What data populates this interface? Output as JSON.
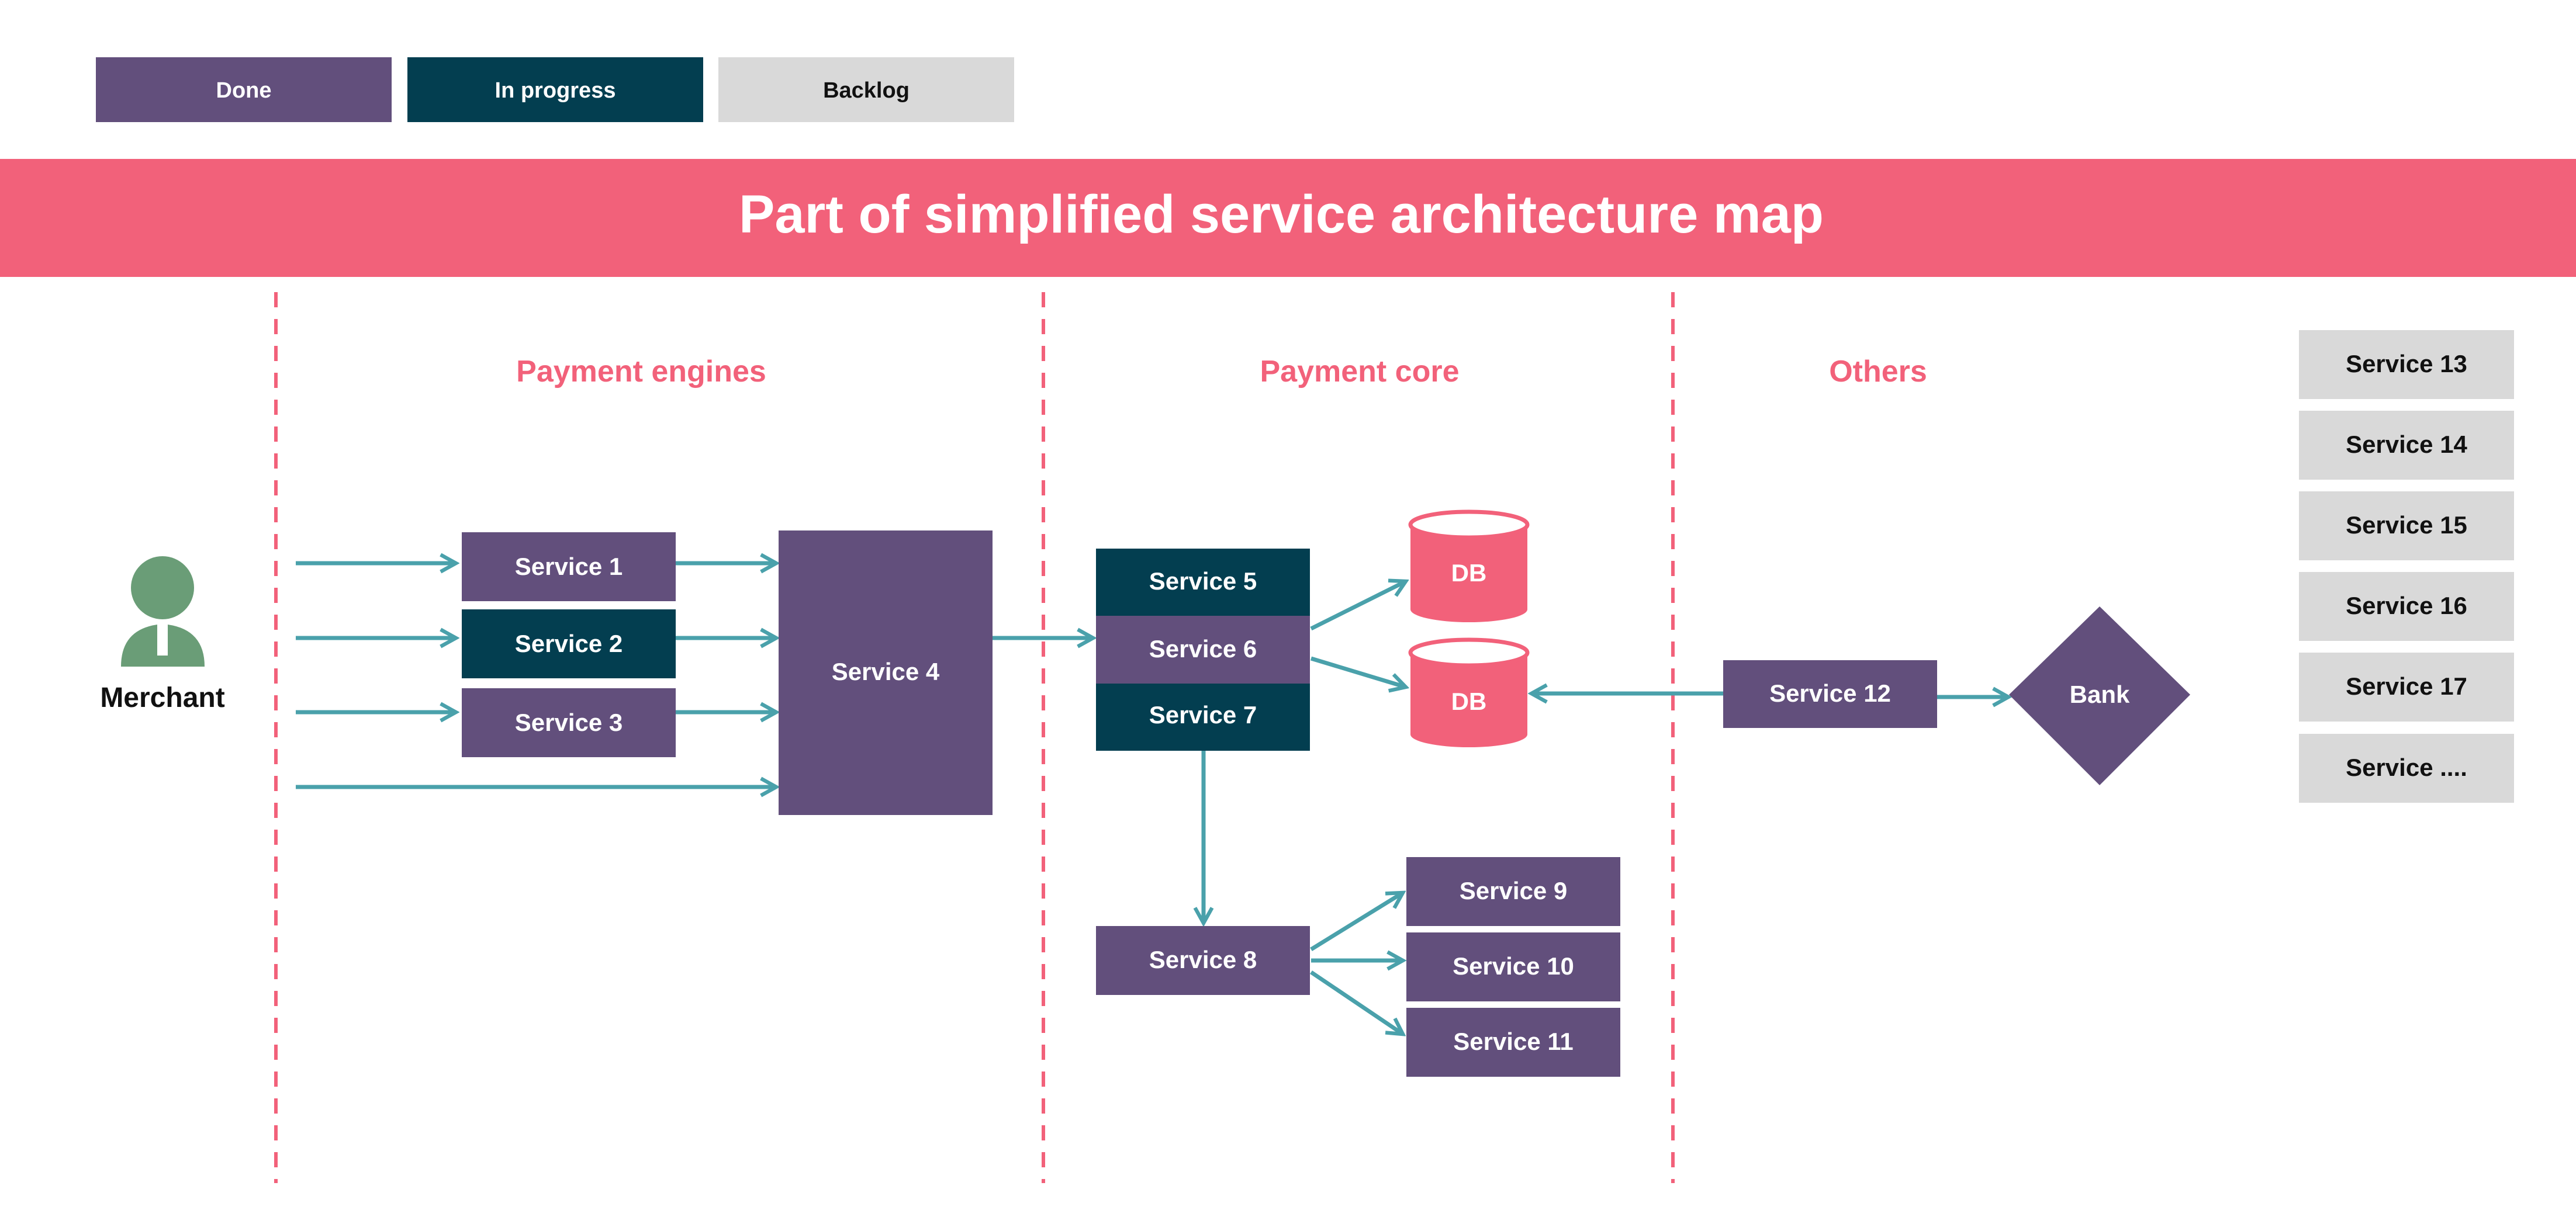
{
  "colors": {
    "done": "#624f7c",
    "in_progress": "#033e50",
    "backlog": "#d9d9d9",
    "accent": "#f2617a",
    "arrow": "#4aa1ab",
    "actor": "#6a9d77",
    "db": "#f2617a"
  },
  "legend": [
    {
      "label": "Done",
      "status": "done"
    },
    {
      "label": "In progress",
      "status": "in_progress"
    },
    {
      "label": "Backlog",
      "status": "backlog"
    }
  ],
  "banner": {
    "title": "Part of simplified service architecture map"
  },
  "sections": [
    {
      "id": "payment-engines",
      "label": "Payment engines"
    },
    {
      "id": "payment-core",
      "label": "Payment core"
    },
    {
      "id": "others",
      "label": "Others"
    }
  ],
  "actor": {
    "label": "Merchant",
    "icon": "person-icon"
  },
  "nodes": [
    {
      "id": "s1",
      "label": "Service 1",
      "status": "done"
    },
    {
      "id": "s2",
      "label": "Service 2",
      "status": "in_progress"
    },
    {
      "id": "s3",
      "label": "Service 3",
      "status": "done"
    },
    {
      "id": "s4",
      "label": "Service 4",
      "status": "done"
    },
    {
      "id": "s5",
      "label": "Service 5",
      "status": "in_progress"
    },
    {
      "id": "s6",
      "label": "Service 6",
      "status": "done"
    },
    {
      "id": "s7",
      "label": "Service 7",
      "status": "in_progress"
    },
    {
      "id": "s8",
      "label": "Service 8",
      "status": "done"
    },
    {
      "id": "s9",
      "label": "Service 9",
      "status": "done"
    },
    {
      "id": "s10",
      "label": "Service 10",
      "status": "done"
    },
    {
      "id": "s11",
      "label": "Service 11",
      "status": "done"
    },
    {
      "id": "s12",
      "label": "Service 12",
      "status": "done"
    },
    {
      "id": "db1",
      "label": "DB",
      "type": "database"
    },
    {
      "id": "db2",
      "label": "DB",
      "type": "database"
    },
    {
      "id": "bank",
      "label": "Bank",
      "type": "external",
      "status": "done"
    }
  ],
  "backlog_list": [
    {
      "label": "Service 13"
    },
    {
      "label": "Service 14"
    },
    {
      "label": "Service 15"
    },
    {
      "label": "Service 16"
    },
    {
      "label": "Service 17"
    },
    {
      "label": "Service ...."
    }
  ],
  "edges": [
    {
      "from": "merchant",
      "to": "s1"
    },
    {
      "from": "merchant",
      "to": "s2"
    },
    {
      "from": "merchant",
      "to": "s3"
    },
    {
      "from": "merchant",
      "to": "s4"
    },
    {
      "from": "s1",
      "to": "s4"
    },
    {
      "from": "s2",
      "to": "s4"
    },
    {
      "from": "s3",
      "to": "s4"
    },
    {
      "from": "s4",
      "to": "s6"
    },
    {
      "from": "s6",
      "to": "db1"
    },
    {
      "from": "s6",
      "to": "db2"
    },
    {
      "from": "s7",
      "to": "s8"
    },
    {
      "from": "s8",
      "to": "s9"
    },
    {
      "from": "s8",
      "to": "s10"
    },
    {
      "from": "s8",
      "to": "s11"
    },
    {
      "from": "s12",
      "to": "db2"
    },
    {
      "from": "s12",
      "to": "bank"
    }
  ]
}
